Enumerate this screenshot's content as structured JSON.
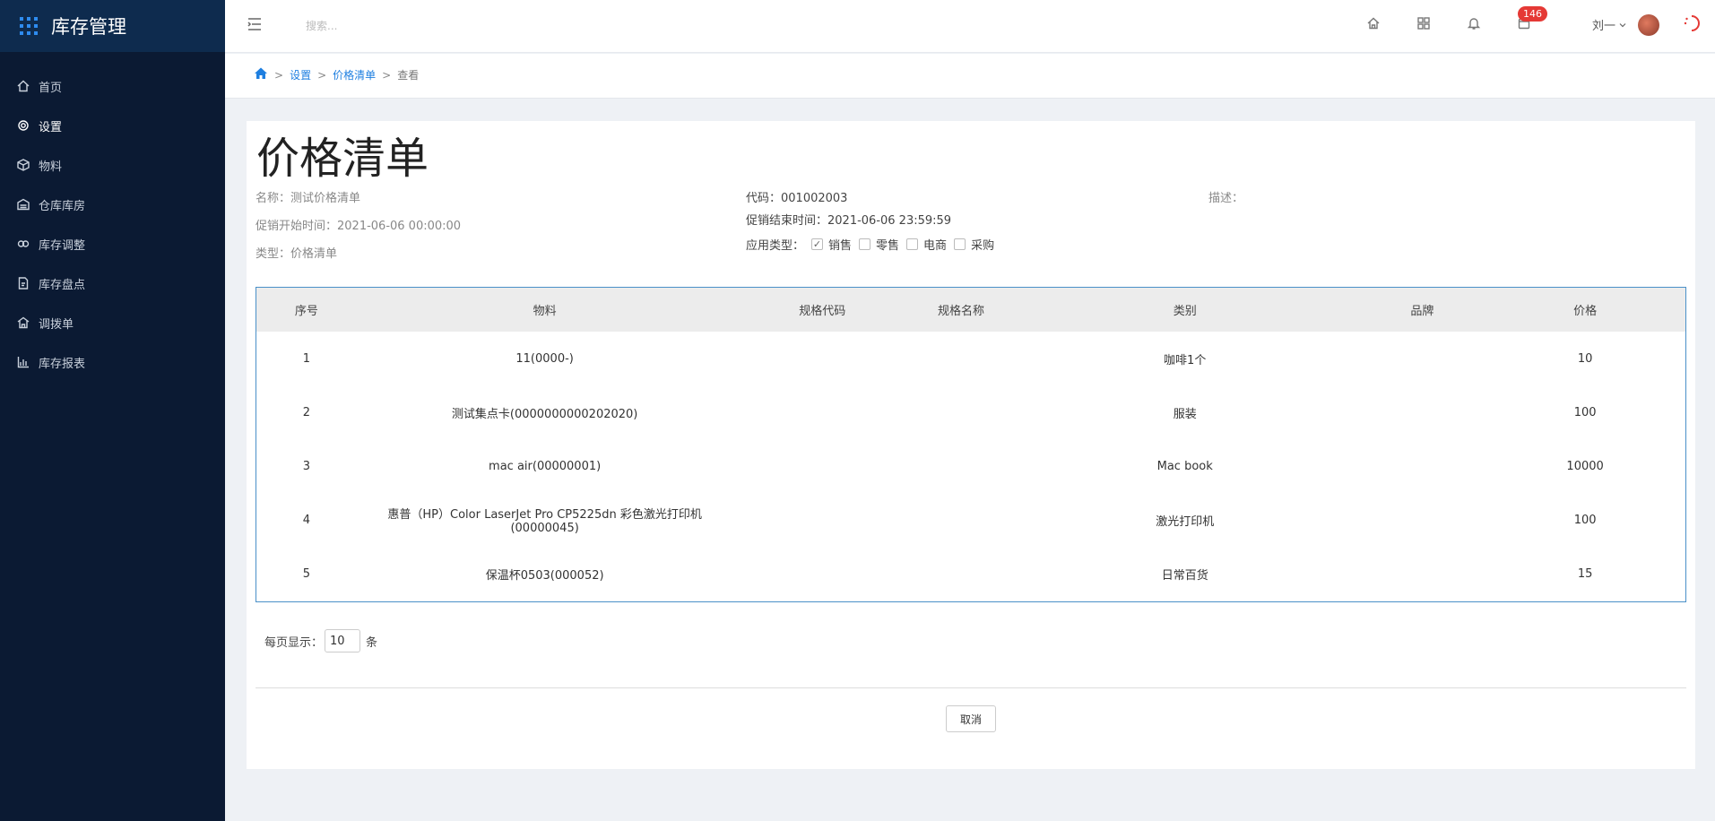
{
  "app": {
    "title": "库存管理"
  },
  "sidebar": {
    "items": [
      {
        "label": "首页",
        "icon": "home-icon"
      },
      {
        "label": "设置",
        "icon": "gear-icon",
        "active": true
      },
      {
        "label": "物料",
        "icon": "box-icon"
      },
      {
        "label": "仓库库房",
        "icon": "warehouse-icon"
      },
      {
        "label": "库存调整",
        "icon": "adjust-icon"
      },
      {
        "label": "库存盘点",
        "icon": "inventory-check-icon"
      },
      {
        "label": "调拨单",
        "icon": "transfer-icon"
      },
      {
        "label": "库存报表",
        "icon": "bar-chart-icon"
      }
    ]
  },
  "header": {
    "search_placeholder": "搜索...",
    "badge_count": "146",
    "user_name": "刘一"
  },
  "breadcrumb": {
    "settings": "设置",
    "price_list": "价格清单",
    "view": "查看",
    "sep": ">"
  },
  "page": {
    "title": "价格清单",
    "name": "名称：测试价格清单",
    "start_time": "促销开始时间：2021-06-06 00:00:00",
    "type": "类型：价格清单",
    "code": "代码：001002003",
    "end_time": "促销结束时间：2021-06-06 23:59:59",
    "apply_label": "应用类型：",
    "apply_types": [
      {
        "label": "销售",
        "checked": true
      },
      {
        "label": "零售",
        "checked": false
      },
      {
        "label": "电商",
        "checked": false
      },
      {
        "label": "采购",
        "checked": false
      }
    ],
    "description": "描述："
  },
  "table": {
    "headers": [
      "序号",
      "物料",
      "规格代码",
      "规格名称",
      "类别",
      "品牌",
      "价格"
    ],
    "rows": [
      [
        "1",
        "11(0000-)",
        "",
        "",
        "咖啡1个",
        "",
        "10"
      ],
      [
        "2",
        "测试集点卡(0000000000202020)",
        "",
        "",
        "服装",
        "",
        "100"
      ],
      [
        "3",
        "mac air(00000001)",
        "",
        "",
        "Mac book",
        "",
        "10000"
      ],
      [
        "4",
        "惠普（HP）Color LaserJet Pro CP5225dn 彩色激光打印机(00000045)",
        "",
        "",
        "激光打印机",
        "",
        "100"
      ],
      [
        "5",
        "保温杯0503(000052)",
        "",
        "",
        "日常百货",
        "",
        "15"
      ]
    ]
  },
  "pagination": {
    "label_before": "每页显示：",
    "page_size": "10",
    "label_after": "条"
  },
  "actions": {
    "cancel": "取消"
  },
  "colors": {
    "sidebar_bg": "#0b1a33",
    "brand_bg": "#0e2b4e",
    "accent": "#1e7fe0",
    "badge": "#e53935"
  }
}
